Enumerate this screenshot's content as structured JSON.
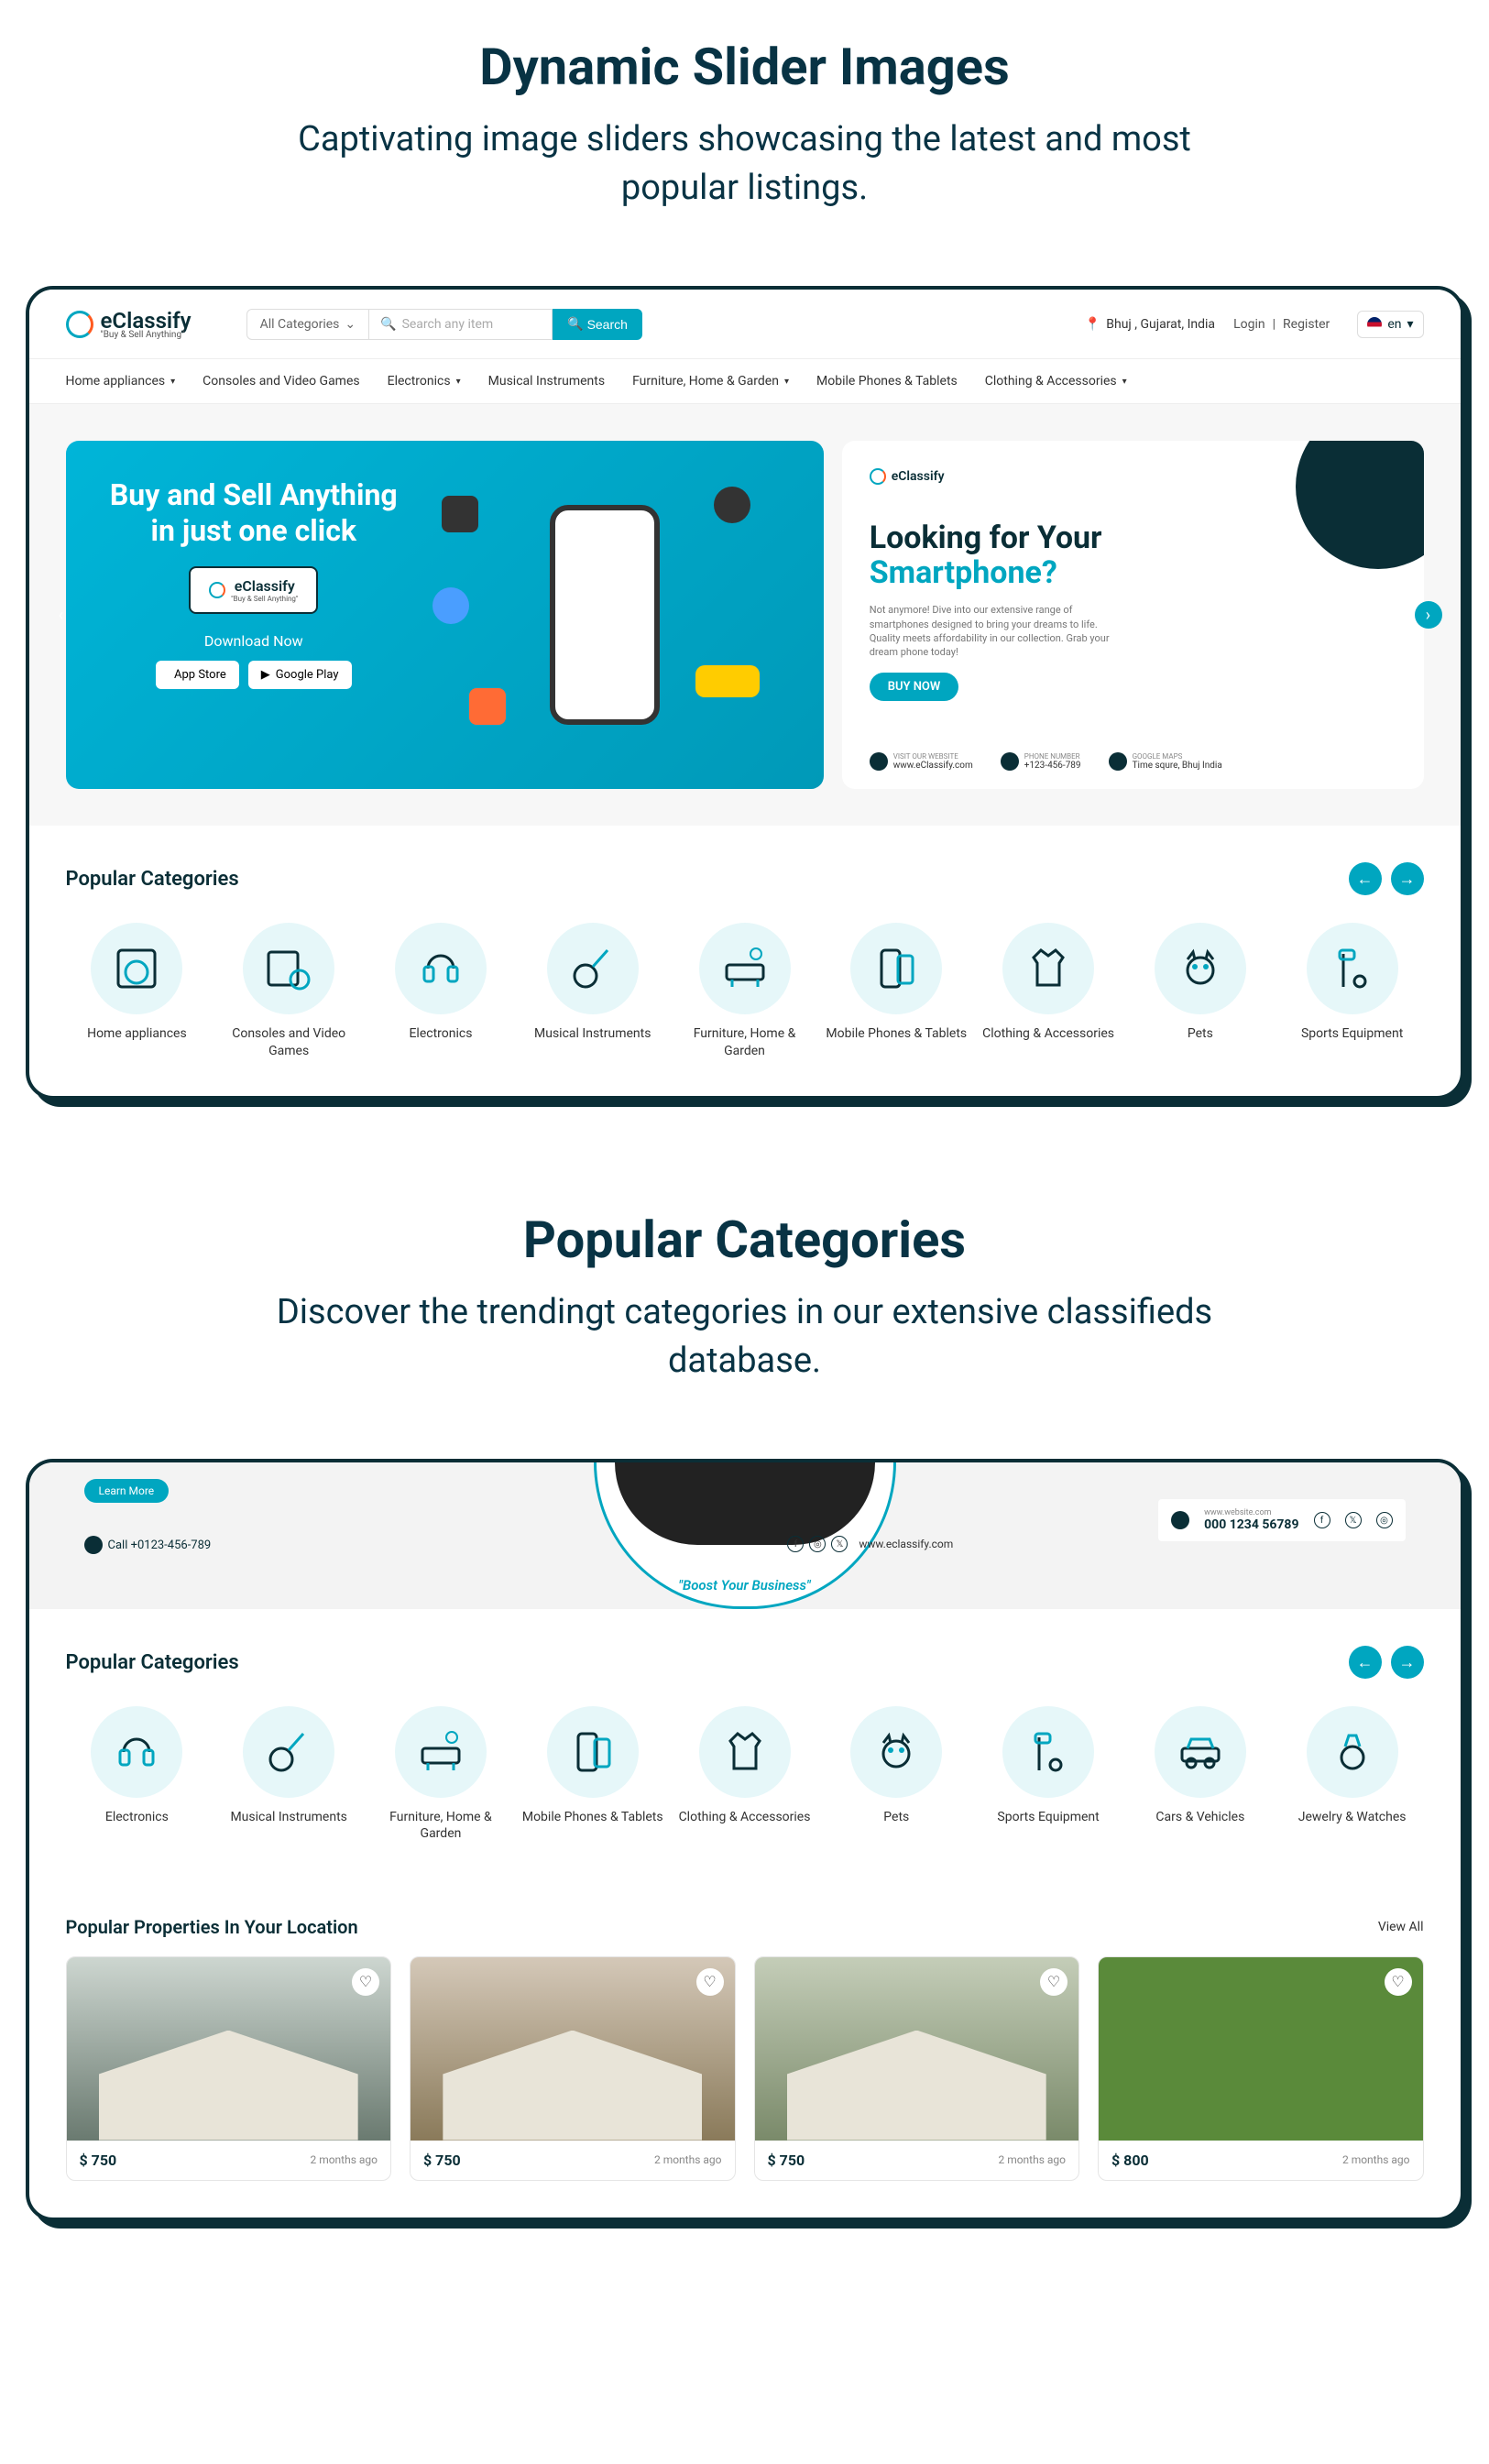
{
  "section1": {
    "title": "Dynamic Slider Images",
    "subtitle": "Captivating image sliders showcasing the latest and most popular listings."
  },
  "header": {
    "brand": "eClassify",
    "tagline": "\"Buy & Sell Anything\"",
    "catSelect": "All Categories",
    "searchPlaceholder": "Search any item",
    "searchBtn": "Search",
    "location": "Bhuj , Gujarat, India",
    "login": "Login",
    "register": "Register",
    "lang": "en"
  },
  "nav": [
    {
      "label": "Home appliances",
      "dropdown": true
    },
    {
      "label": "Consoles and Video Games",
      "dropdown": false
    },
    {
      "label": "Electronics",
      "dropdown": true
    },
    {
      "label": "Musical Instruments",
      "dropdown": false
    },
    {
      "label": "Furniture, Home & Garden",
      "dropdown": true
    },
    {
      "label": "Mobile Phones & Tablets",
      "dropdown": false
    },
    {
      "label": "Clothing & Accessories",
      "dropdown": true
    }
  ],
  "slide1": {
    "title": "Buy and Sell Anything in just one click",
    "badgeBrand": "eClassify",
    "badgeTag": "\"Buy & Sell Anything\"",
    "download": "Download Now",
    "appstore": "App Store",
    "googleplay": "Google Play"
  },
  "slide2": {
    "brand": "eClassify",
    "titleL1": "Looking for Your",
    "titleL2": "Smartphone?",
    "desc": "Not anymore! Dive into our extensive range of smartphones designed to bring your dreams to life. Quality meets affordability in our collection. Grab your dream phone today!",
    "btn": "BUY NOW",
    "website": "www.eClassify.com",
    "phone": "+123-456-789",
    "addr": "Time squre, Bhuj India",
    "websiteLabel": "VISIT OUR WEBSITE",
    "phoneLabel": "PHONE NUMBER",
    "addrLabel": "GOOGLE MAPS"
  },
  "categories1": {
    "title": "Popular Categories",
    "items": [
      {
        "label": "Home appliances"
      },
      {
        "label": "Consoles and Video Games"
      },
      {
        "label": "Electronics"
      },
      {
        "label": "Musical Instruments"
      },
      {
        "label": "Furniture, Home & Garden"
      },
      {
        "label": "Mobile Phones & Tablets"
      },
      {
        "label": "Clothing & Accessories"
      },
      {
        "label": "Pets"
      },
      {
        "label": "Sports Equipment"
      }
    ]
  },
  "section2": {
    "title": "Popular Categories",
    "subtitle": "Discover the trendingt categories in our extensive classifieds database."
  },
  "banner": {
    "learnMore": "Learn More",
    "call": "Call +0123-456-789",
    "boost": "\"Boost Your Business\"",
    "site": "www.eclassify.com",
    "rightSite": "www.website.com",
    "rightPhone": "000 1234 56789"
  },
  "categories2": {
    "title": "Popular Categories",
    "items": [
      {
        "label": "Electronics"
      },
      {
        "label": "Musical Instruments"
      },
      {
        "label": "Furniture, Home & Garden"
      },
      {
        "label": "Mobile Phones & Tablets"
      },
      {
        "label": "Clothing & Accessories"
      },
      {
        "label": "Pets"
      },
      {
        "label": "Sports Equipment"
      },
      {
        "label": "Cars & Vehicles"
      },
      {
        "label": "Jewelry & Watches"
      }
    ]
  },
  "properties": {
    "title": "Popular Properties In Your Location",
    "viewAll": "View All",
    "items": [
      {
        "price": "$ 750",
        "time": "2 months ago",
        "img": "house1"
      },
      {
        "price": "$ 750",
        "time": "2 months ago",
        "img": "house2"
      },
      {
        "price": "$ 750",
        "time": "2 months ago",
        "img": "house3"
      },
      {
        "price": "$ 800",
        "time": "2 months ago",
        "img": "land"
      }
    ]
  }
}
